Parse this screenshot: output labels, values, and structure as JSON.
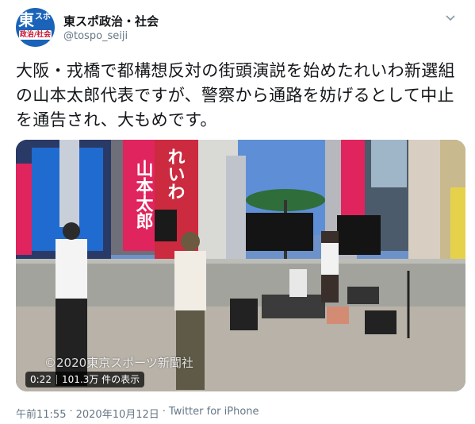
{
  "account": {
    "display_name": "東スポ政治・社会",
    "handle": "@tospo_seiji",
    "avatar_text_main": "東",
    "avatar_text_top": "スポ",
    "avatar_text_sub": "政治/社会"
  },
  "tweet": {
    "text": "大阪・戎橋で都構想反対の街頭演説を始めたれいわ新選組の山本太郎代表ですが、警察から通路を妨げるとして中止を通告され、大もめです。"
  },
  "video": {
    "watermark": "©2020東京スポーツ新聞社",
    "duration": "0:22",
    "views": "101.3万 件の表示",
    "banner_left": "山本太郎",
    "banner_right": "れいわ"
  },
  "meta": {
    "time": "午前11:55",
    "separator": "·",
    "date": "2020年10月12日",
    "source": "Twitter for iPhone"
  },
  "colors": {
    "brand_blue": "#1a63b8",
    "banner_pink": "#e0245e",
    "muted": "#657786"
  }
}
